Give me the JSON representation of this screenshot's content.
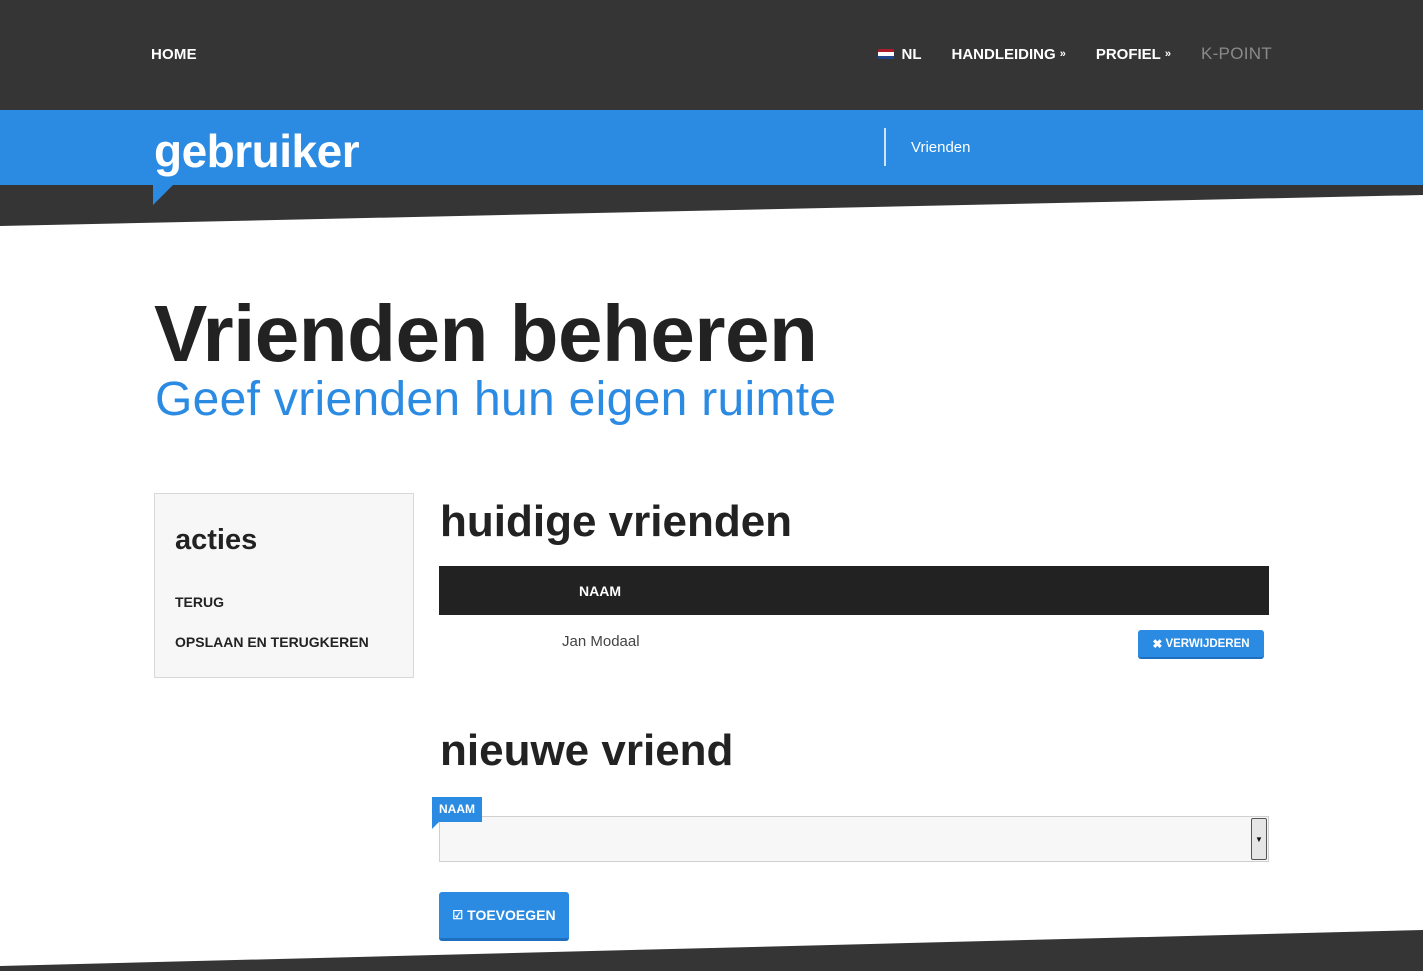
{
  "nav": {
    "home": "HOME",
    "language": "NL",
    "language_flag": "dutch-flag-icon",
    "manual": "HANDLEIDING",
    "profile": "PROFIEL",
    "brand_right": "K-POINT"
  },
  "header": {
    "brand": "gebruiker",
    "breadcrumb": "Vrienden"
  },
  "page": {
    "title": "Vrienden beheren",
    "subtitle": "Geef vrienden hun eigen ruimte"
  },
  "sidebar": {
    "title": "acties",
    "links": [
      "TERUG",
      "OPSLAAN EN TERUGKEREN"
    ]
  },
  "current_friends": {
    "title": "huidige vrienden",
    "column_name": "NAAM",
    "rows": [
      {
        "name": "Jan Modaal",
        "action": "VERWIJDEREN"
      }
    ]
  },
  "new_friend": {
    "title": "nieuwe vriend",
    "field_label": "NAAM",
    "select_value": "",
    "submit": "TOEVOEGEN"
  },
  "colors": {
    "accent": "#2b8be3",
    "dark": "#353535",
    "table_header": "#222222"
  }
}
